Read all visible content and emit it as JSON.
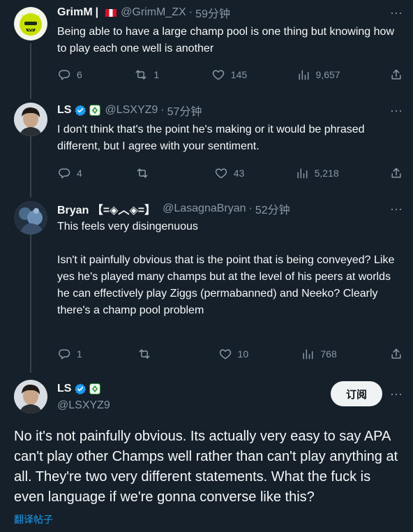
{
  "colors": {
    "background": "#15202b",
    "text": "#f7f9f9",
    "muted": "#8b98a5",
    "accent": "#1d9bf0",
    "subscribe_bg": "#eff3f4"
  },
  "tweets": [
    {
      "name": "GrimM",
      "name_suffix": "|",
      "handle": "@GrimM_ZX",
      "dot": "·",
      "time": "59分钟",
      "text": "Being able to have a large champ pool is one thing but knowing how to play each one well is another",
      "replies": "6",
      "retweets": "1",
      "likes": "145",
      "views": "9,657"
    },
    {
      "name": "LS",
      "handle": "@LSXYZ9",
      "dot": "·",
      "time": "57分钟",
      "text": "I don't think that's the point he's making or it would be phrased different, but I agree with your sentiment.",
      "replies": "4",
      "retweets": "",
      "likes": "43",
      "views": "5,218"
    },
    {
      "name": "Bryan 【=◈︿◈=】",
      "handle": "@LasagnaBryan",
      "dot": "·",
      "time": "52分钟",
      "text": "This feels very disingenuous\n\nIsn't it painfully obvious that is the point that is being conveyed? Like yes he's played many champs but at the level of his peers at worlds he can effectively play Ziggs (permabanned) and Neeko? Clearly there's a champ pool problem",
      "replies": "1",
      "retweets": "",
      "likes": "10",
      "views": "768"
    }
  ],
  "main_tweet": {
    "name": "LS",
    "handle": "@LSXYZ9",
    "subscribe_label": "订阅",
    "text": "No it's not painfully obvious. Its actually very easy to say APA can't play other Champs well rather than can't play anything at all. They're two very different statements. What the fuck is even language if we're gonna converse like this?",
    "translate_label": "翻译帖子"
  },
  "icons": {
    "reply": "reply-icon",
    "retweet": "retweet-icon",
    "like": "heart-icon",
    "views": "views-icon",
    "share": "share-icon",
    "more": "more-icon",
    "verified": "verified-badge-icon",
    "affiliate": "affiliate-badge-icon"
  }
}
